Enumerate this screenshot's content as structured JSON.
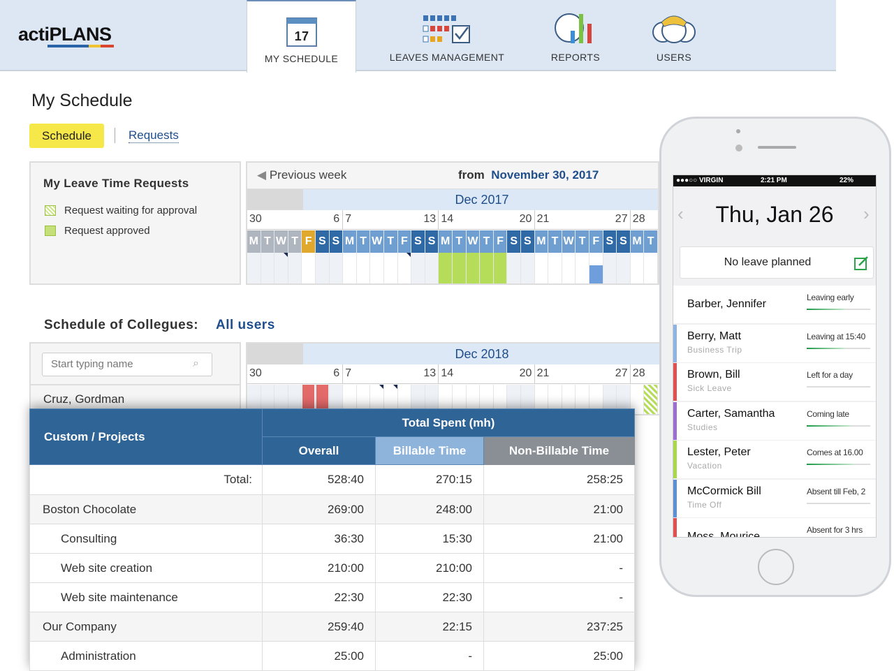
{
  "app": {
    "logo": "actiPLANS"
  },
  "nav": [
    {
      "label": "MY SCHEDULE",
      "icon": "calendar-icon",
      "badge": "17"
    },
    {
      "label": "LEAVES MANAGEMENT",
      "icon": "leave-grid-icon"
    },
    {
      "label": "REPORTS",
      "icon": "chart-icon"
    },
    {
      "label": "USERS",
      "icon": "users-icon"
    }
  ],
  "page": {
    "title": "My Schedule",
    "tabs": {
      "schedule": "Schedule",
      "requests": "Requests"
    }
  },
  "legend": {
    "title": "My Leave Time Requests",
    "items": [
      {
        "label": "Request waiting for approval",
        "color": "#cfe58a",
        "hatched": true
      },
      {
        "label": "Request approved",
        "color": "#c5e07a",
        "hatched": false
      }
    ]
  },
  "calendar1": {
    "prev": "Previous week",
    "from_label": "from",
    "from_date": "November 30, 2017",
    "month": "Dec 2017",
    "week_labels": [
      {
        "t": "30",
        "c": 0,
        "a": "l"
      },
      {
        "t": "6",
        "c": 6,
        "a": "r"
      },
      {
        "t": "7",
        "c": 7,
        "a": "l"
      },
      {
        "t": "13",
        "c": 13,
        "a": "r"
      },
      {
        "t": "14",
        "c": 14,
        "a": "l"
      },
      {
        "t": "20",
        "c": 20,
        "a": "r"
      },
      {
        "t": "21",
        "c": 21,
        "a": "l"
      },
      {
        "t": "27",
        "c": 27,
        "a": "r"
      },
      {
        "t": "28",
        "c": 28,
        "a": "l"
      }
    ],
    "days": [
      "M",
      "T",
      "W",
      "T",
      "F",
      "S",
      "S",
      "M",
      "T",
      "W",
      "T",
      "F",
      "S",
      "S",
      "M",
      "T",
      "W",
      "T",
      "F",
      "S",
      "S",
      "M",
      "T",
      "W",
      "T",
      "F",
      "S",
      "S",
      "M",
      "T"
    ],
    "today_index": 4,
    "approved_days": [
      14,
      15,
      16,
      17,
      18
    ],
    "event_days": [
      25
    ],
    "marker_days": [
      2,
      11
    ]
  },
  "colleagues": {
    "title": "Schedule of Collegues:",
    "filter": "All users",
    "search_placeholder": "Start typing name",
    "first_user": "Cruz, Gordman"
  },
  "calendar2": {
    "month": "Dec 2018",
    "sick_days": [
      4,
      5
    ],
    "marker_days": [
      9,
      10
    ],
    "pending_days": [
      29
    ]
  },
  "report": {
    "col1": "Custom / Projects",
    "group": "Total Spent (mh)",
    "cols": [
      "Overall",
      "Billable Time",
      "Non-Billable Time"
    ],
    "total": {
      "label": "Total:",
      "values": [
        "528:40",
        "270:15",
        "258:25"
      ]
    },
    "rows": [
      {
        "name": "Boston Chocolate",
        "level": 0,
        "values": [
          "269:00",
          "248:00",
          "21:00"
        ]
      },
      {
        "name": "Consulting",
        "level": 1,
        "values": [
          "36:30",
          "15:30",
          "21:00"
        ]
      },
      {
        "name": "Web site creation",
        "level": 1,
        "values": [
          "210:00",
          "210:00",
          "-"
        ]
      },
      {
        "name": "Web site maintenance",
        "level": 1,
        "values": [
          "22:30",
          "22:30",
          "-"
        ]
      },
      {
        "name": "Our Company",
        "level": 0,
        "values": [
          "259:40",
          "22:15",
          "237:25"
        ]
      },
      {
        "name": "Administration",
        "level": 1,
        "values": [
          "25:00",
          "-",
          "25:00"
        ]
      }
    ]
  },
  "phone": {
    "carrier": "●●●○○ VIRGIN",
    "time": "2:21 PM",
    "battery": "22%",
    "date": "Thu, Jan 26",
    "no_leave": "No leave planned",
    "people": [
      {
        "name": "Barber, Jennifer",
        "type": "",
        "status": "Leaving early",
        "color": "",
        "progress": 0.6
      },
      {
        "name": "Berry, Matt",
        "type": "Business Trip",
        "status": "Leaving at 15:40",
        "color": "#8db4e2",
        "progress": 0.6
      },
      {
        "name": "Brown, Bill",
        "type": "Sick Leave",
        "status": "Left for a day",
        "color": "#e05050",
        "progress": 0
      },
      {
        "name": "Carter, Samantha",
        "type": "Studies",
        "status": "Coming late",
        "color": "#9b6fd0",
        "progress": 0.7
      },
      {
        "name": "Lester, Peter",
        "type": "Vacation",
        "status": "Comes at 16.00",
        "color": "#a6d84a",
        "progress": 0.75
      },
      {
        "name": "McCormick Bill",
        "type": "Time Off",
        "status": "Absent till Feb, 2",
        "color": "#5b8fd6",
        "progress": 0
      },
      {
        "name": "Moss, Mourice",
        "type": "",
        "status": "Absent for 3 hrs",
        "color": "#e05050",
        "progress": 0
      }
    ]
  }
}
